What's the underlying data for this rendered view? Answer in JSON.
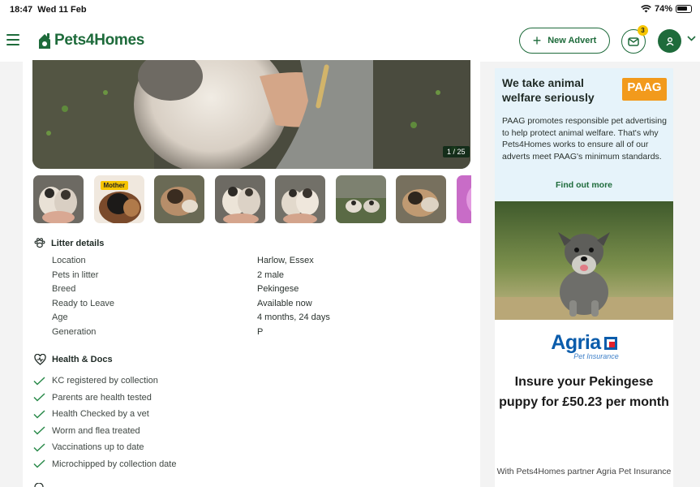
{
  "status_bar": {
    "time": "18:47",
    "date": "Wed 11 Feb",
    "battery": "74%"
  },
  "header": {
    "brand": "Pets4Homes",
    "new_advert_label": "New Advert",
    "messages_badge": "3"
  },
  "gallery": {
    "counter": "1 / 25",
    "mother_tag": "Mother"
  },
  "litter_details": {
    "title": "Litter details",
    "rows": [
      {
        "label": "Location",
        "value": "Harlow, Essex"
      },
      {
        "label": "Pets in litter",
        "value": "2 male"
      },
      {
        "label": "Breed",
        "value": "Pekingese"
      },
      {
        "label": "Ready to Leave",
        "value": "Available now"
      },
      {
        "label": "Age",
        "value": "4 months, 24 days"
      },
      {
        "label": "Generation",
        "value": "P"
      }
    ]
  },
  "health": {
    "title": "Health & Docs",
    "items": [
      "KC registered by collection",
      "Parents are health tested",
      "Health Checked by a vet",
      "Worm and flea treated",
      "Vaccinations up to date",
      "Microchipped by collection date"
    ]
  },
  "paag": {
    "title": "We take animal welfare seriously",
    "logo_text": "PAAG",
    "text": "PAAG promotes responsible pet advertising to help protect animal welfare. That's why Pets4Homes works to ensure all of our adverts meet PAAG's minimum standards.",
    "link": "Find out more"
  },
  "agria_ad": {
    "brand": "Agria",
    "subtitle": "Pet Insurance",
    "headline": "Insure your Pekingese puppy for £50.23 per month",
    "partner_text": "With Pets4Homes partner Agria Pet Insurance"
  },
  "colors": {
    "brand_green": "#1e6b3b",
    "badge_yellow": "#f5c400",
    "paag_bg": "#e6f3fa",
    "agria_blue": "#0b5cab"
  }
}
